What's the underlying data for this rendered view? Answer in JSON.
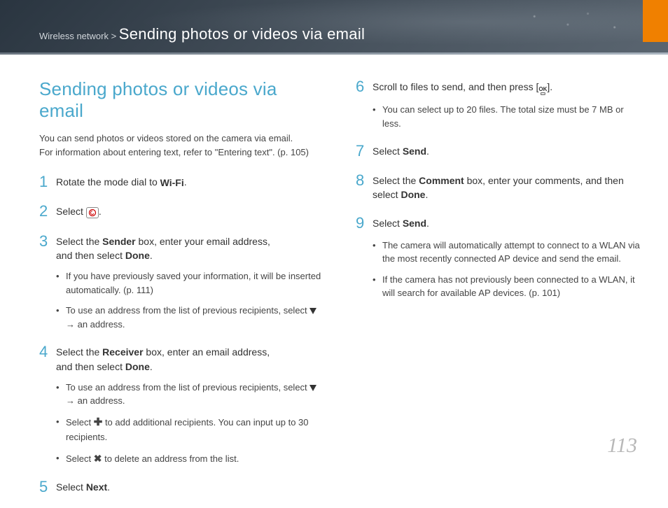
{
  "header": {
    "crumb_prefix": "Wireless network >",
    "crumb_title": "Sending photos or videos via email"
  },
  "section_title": "Sending photos or videos via email",
  "intro_line1": "You can send photos or videos stored on the camera via email.",
  "intro_line2": "For information about entering text, refer to \"Entering text\". (p. 105)",
  "steps": {
    "s1": {
      "num": "1",
      "pre": "Rotate the mode dial to ",
      "wifi": "Wi-Fi",
      "post": "."
    },
    "s2": {
      "num": "2",
      "pre": "Select ",
      "post": "."
    },
    "s3": {
      "num": "3",
      "line_a": "Select the ",
      "bold_a": "Sender",
      "line_b": " box, enter your email address,",
      "line_c": "and then select ",
      "bold_b": "Done",
      "line_d": ".",
      "b1": "If you have previously saved your information, it will be inserted automatically. (p. 111)",
      "b2a": "To use an address from the list of previous recipients, select ",
      "b2b": " → an address."
    },
    "s4": {
      "num": "4",
      "line_a": "Select the ",
      "bold_a": "Receiver",
      "line_b": " box, enter an email address,",
      "line_c": "and then select ",
      "bold_b": "Done",
      "line_d": ".",
      "b1a": "To use an address from the list of previous recipients, select ",
      "b1b": " → an address.",
      "b2a": "Select ",
      "b2b": " to add additional recipients. You can input up to 30 recipients.",
      "b3a": "Select ",
      "b3b": " to delete an address from the list."
    },
    "s5": {
      "num": "5",
      "pre": "Select ",
      "bold": "Next",
      "post": "."
    },
    "s6": {
      "num": "6",
      "pre": "Scroll to files to send, and then press [",
      "post": "].",
      "b1": "You can select up to 20 files. The total size must be 7 MB or less."
    },
    "s7": {
      "num": "7",
      "pre": "Select ",
      "bold": "Send",
      "post": "."
    },
    "s8": {
      "num": "8",
      "line_a": "Select the ",
      "bold_a": "Comment",
      "line_b": " box, enter your comments, and then select ",
      "bold_b": "Done",
      "line_c": "."
    },
    "s9": {
      "num": "9",
      "pre": "Select ",
      "bold": "Send",
      "post": ".",
      "b1": "The camera will automatically attempt to connect to a WLAN via the most recently connected AP device and send the email.",
      "b2": "If the camera has not previously been connected to a WLAN, it will search for available AP devices. (p. 101)"
    }
  },
  "page_number": "113"
}
